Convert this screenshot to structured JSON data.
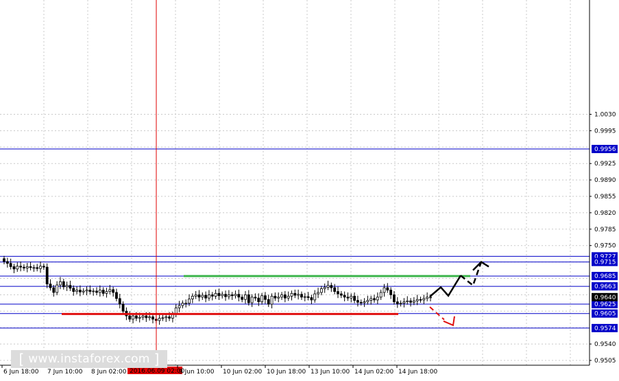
{
  "watermark": {
    "text": "www.instaforex.com"
  },
  "crosshair": {
    "time_label": "2016.06.09 02:00"
  },
  "colors": {
    "grid": "#c8c8c8",
    "level": "#0000c8",
    "resistance": "#3cb44b",
    "support": "#e01010",
    "cursor": "#e00000",
    "candle": "#000000",
    "tag_bg": "#0000c8",
    "tag_text": "#ffffff",
    "current_tag_bg": "#000000"
  },
  "chart_data": {
    "type": "candlestick",
    "title": "",
    "ylim": [
      0.9505,
      1.003
    ],
    "y_ticks": [
      "1.0030",
      "0.9995",
      "0.9925",
      "0.9890",
      "0.9855",
      "0.9820",
      "0.9785",
      "0.9750",
      "0.9540",
      "0.9505"
    ],
    "x_ticks": [
      "6 Jun 18:00",
      "7 Jun 10:00",
      "8 Jun 02:00",
      "9 Jun 10:00",
      "10 Jun 02:00",
      "10 Jun 18:00",
      "13 Jun 10:00",
      "14 Jun 02:00",
      "14 Jun 18:00"
    ],
    "levels": [
      {
        "price": 0.9956,
        "label": "0.9956"
      },
      {
        "price": 0.9727,
        "label": "0.9727"
      },
      {
        "price": 0.9715,
        "label": "0.9715"
      },
      {
        "price": 0.9685,
        "label": "0.9685"
      },
      {
        "price": 0.9663,
        "label": "0.9663"
      },
      {
        "price": 0.9625,
        "label": "0.9625"
      },
      {
        "price": 0.9605,
        "label": "0.9605"
      },
      {
        "price": 0.9574,
        "label": "0.9574"
      }
    ],
    "current_price": {
      "price": 0.964,
      "label": "0.9640"
    },
    "resistance": {
      "price": 0.9685
    },
    "support": {
      "price": 0.9604
    },
    "forecast_up": [
      0.9641,
      0.9661,
      0.9643,
      0.9686,
      0.9665,
      0.9715,
      0.9705
    ],
    "forecast_down": [
      0.9619,
      0.9592,
      0.958
    ],
    "closes": [
      0.9716,
      0.9712,
      0.9705,
      0.97,
      0.9706,
      0.9704,
      0.9702,
      0.9705,
      0.9703,
      0.9703,
      0.9701,
      0.9706,
      0.9704,
      0.9668,
      0.966,
      0.965,
      0.9666,
      0.9673,
      0.9662,
      0.9665,
      0.9659,
      0.9652,
      0.9655,
      0.9651,
      0.9653,
      0.9655,
      0.9652,
      0.9653,
      0.965,
      0.9655,
      0.9648,
      0.9652,
      0.9656,
      0.965,
      0.9637,
      0.9625,
      0.961,
      0.96,
      0.9593,
      0.96,
      0.9595,
      0.9597,
      0.96,
      0.9596,
      0.9598,
      0.9593,
      0.959,
      0.9595,
      0.9596,
      0.9598,
      0.9595,
      0.9603,
      0.9617,
      0.9622,
      0.9627,
      0.9627,
      0.9636,
      0.9642,
      0.9645,
      0.964,
      0.9644,
      0.9638,
      0.9645,
      0.9642,
      0.9648,
      0.9643,
      0.9646,
      0.9641,
      0.9645,
      0.9643,
      0.9646,
      0.964,
      0.9635,
      0.9645,
      0.9628,
      0.964,
      0.9638,
      0.963,
      0.9643,
      0.9635,
      0.9625,
      0.9642,
      0.9638,
      0.964,
      0.9645,
      0.9638,
      0.9642,
      0.9648,
      0.9644,
      0.9646,
      0.964,
      0.9641,
      0.9639,
      0.9634,
      0.9647,
      0.965,
      0.9658,
      0.9661,
      0.9665,
      0.966,
      0.9652,
      0.9647,
      0.9644,
      0.964,
      0.9638,
      0.9642,
      0.9633,
      0.9629,
      0.9628,
      0.963,
      0.9633,
      0.9637,
      0.9634,
      0.964,
      0.965,
      0.966,
      0.9655,
      0.9645,
      0.963,
      0.9626,
      0.9627,
      0.963,
      0.9632,
      0.9629,
      0.9632,
      0.9635,
      0.9634,
      0.9637,
      0.964,
      0.964
    ]
  }
}
